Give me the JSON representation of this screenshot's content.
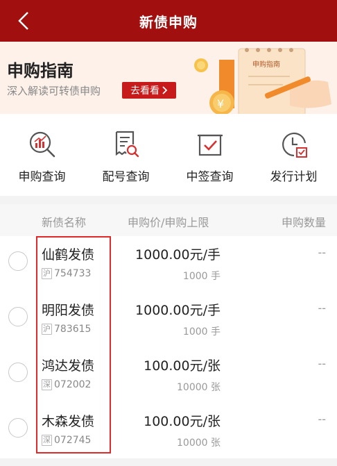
{
  "header": {
    "title": "新债申购"
  },
  "banner": {
    "title": "申购指南",
    "subtitle": "深入解读可转债申购",
    "button_label": "去看看",
    "illustration_caption": "申购指南"
  },
  "quick_nav": [
    {
      "label": "申购查询",
      "icon": "magnifier-chart-icon"
    },
    {
      "label": "配号查询",
      "icon": "document-search-icon"
    },
    {
      "label": "中签查询",
      "icon": "checkbox-tray-icon"
    },
    {
      "label": "发行计划",
      "icon": "clock-calendar-icon"
    }
  ],
  "table": {
    "headers": {
      "name": "新债名称",
      "price": "申购价/申购上限",
      "qty": "申购数量"
    },
    "rows": [
      {
        "name": "仙鹤发债",
        "market": "沪",
        "code": "754733",
        "price": "1000.00元/手",
        "limit": "1000 手",
        "qty": "--"
      },
      {
        "name": "明阳发债",
        "market": "沪",
        "code": "783615",
        "price": "1000.00元/手",
        "limit": "1000 手",
        "qty": "--"
      },
      {
        "name": "鸿达发债",
        "market": "深",
        "code": "072002",
        "price": "100.00元/张",
        "limit": "10000 张",
        "qty": "--"
      },
      {
        "name": "木森发债",
        "market": "深",
        "code": "072745",
        "price": "100.00元/张",
        "limit": "10000 张",
        "qty": "--"
      }
    ]
  },
  "colors": {
    "header_bg": "#a10f0f",
    "accent": "#c71b1b",
    "highlight": "#e02a2a"
  }
}
